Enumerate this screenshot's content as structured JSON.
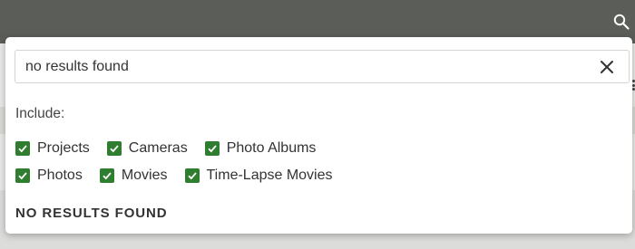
{
  "header": {
    "search_icon": "search-icon"
  },
  "search": {
    "value": "no results found",
    "clear_icon": "close-icon"
  },
  "filters": {
    "heading": "Include:",
    "checked_color": "#2f7d2f",
    "options": [
      {
        "label": "Projects",
        "checked": true
      },
      {
        "label": "Cameras",
        "checked": true
      },
      {
        "label": "Photo Albums",
        "checked": true
      },
      {
        "label": "Photos",
        "checked": true
      },
      {
        "label": "Movies",
        "checked": true
      },
      {
        "label": "Time-Lapse Movies",
        "checked": true
      }
    ]
  },
  "results": {
    "message": "NO RESULTS FOUND"
  }
}
